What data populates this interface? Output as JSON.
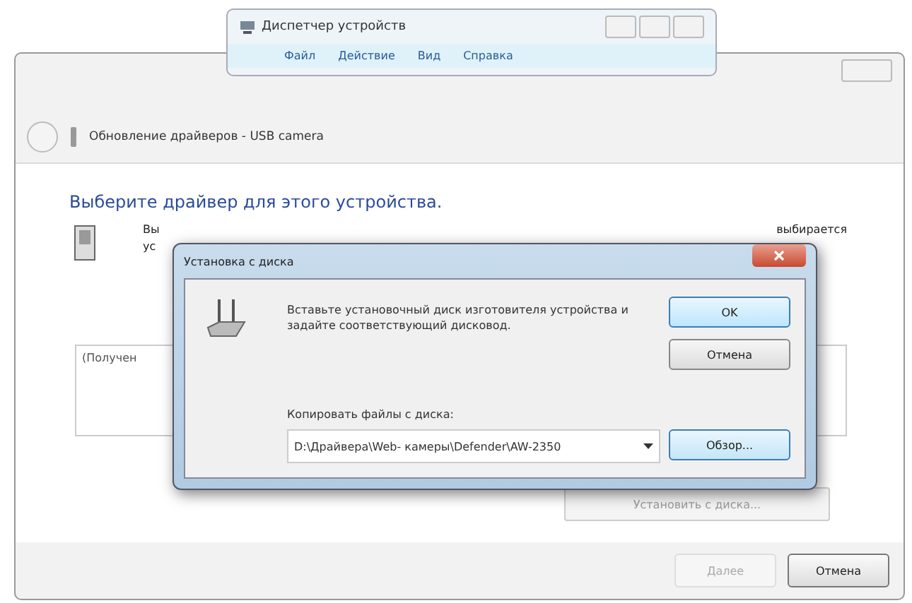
{
  "device_manager": {
    "title": "Диспетчер устройств",
    "menu": [
      "Файл",
      "Действие",
      "Вид",
      "Справка"
    ]
  },
  "wizard": {
    "title": "Обновление драйверов - USB camera",
    "heading": "Выберите драйвер для этого устройства.",
    "fragments": [
      "Вы",
      "выбирается",
      "ус"
    ],
    "list_text": "(Получен",
    "have_disk_button": {
      "label": "Установить с диска...",
      "disabled": true
    },
    "buttons": [
      {
        "label": "Далее",
        "disabled": true
      },
      {
        "label": "Отмена",
        "disabled": false
      }
    ]
  },
  "install_dialog": {
    "title": "Установка с диска",
    "message": "Вставьте установочный диск изготовителя устройства и задайте соответствующий дисковод.",
    "copy_label": "Копировать файлы с диска:",
    "path": "D:\\Драйвера\\Web- камеры\\Defender\\AW-2350",
    "buttons": [
      {
        "label": "OK",
        "kind": "default"
      },
      {
        "label": "Отмена",
        "kind": "normal"
      }
    ],
    "browse": "Обзор..."
  }
}
